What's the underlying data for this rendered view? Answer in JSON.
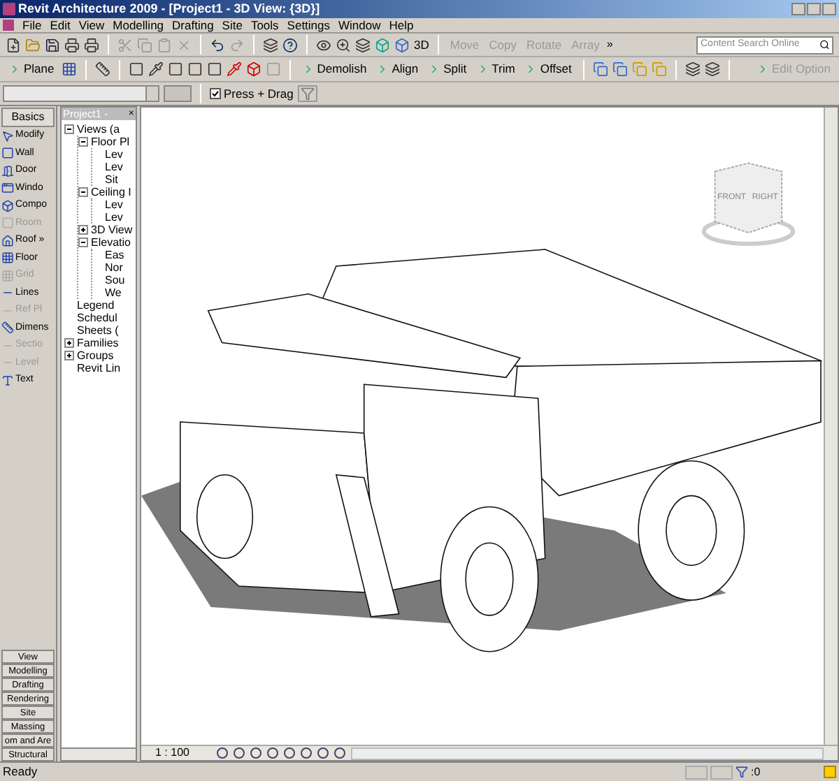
{
  "window": {
    "title": "Revit Architecture 2009 - [Project1 - 3D View: {3D}]"
  },
  "menu": [
    "File",
    "Edit",
    "View",
    "Modelling",
    "Drafting",
    "Site",
    "Tools",
    "Settings",
    "Window",
    "Help"
  ],
  "standard_toolbar": {
    "view_3d": "3D",
    "edit_tools": [
      {
        "label": "Move",
        "disabled": true
      },
      {
        "label": "Copy",
        "disabled": true
      },
      {
        "label": "Rotate",
        "disabled": true
      },
      {
        "label": "Array",
        "disabled": true
      }
    ],
    "overflow": "»"
  },
  "search": {
    "placeholder": "Content Search Online"
  },
  "tools_toolbar": [
    {
      "label": "Plane",
      "disabled": false
    },
    {
      "label": "Demolish",
      "disabled": false
    },
    {
      "label": "Align",
      "disabled": false
    },
    {
      "label": "Split",
      "disabled": false
    },
    {
      "label": "Trim",
      "disabled": false
    },
    {
      "label": "Offset",
      "disabled": false
    },
    {
      "label": "Edit Option",
      "disabled": true
    }
  ],
  "options_bar": {
    "press_drag": {
      "label": "Press + Drag",
      "checked": true
    }
  },
  "design_bar": {
    "tab": "Basics",
    "tools": [
      {
        "label": "Modify",
        "disabled": false
      },
      {
        "label": "Wall",
        "disabled": false
      },
      {
        "label": "Door",
        "disabled": false
      },
      {
        "label": "Windo",
        "disabled": false
      },
      {
        "label": "Compo",
        "disabled": false
      },
      {
        "label": "Room",
        "disabled": true
      },
      {
        "label": "Roof »",
        "disabled": false
      },
      {
        "label": "Floor",
        "disabled": false
      },
      {
        "label": "Grid",
        "disabled": true
      },
      {
        "label": "Lines",
        "disabled": false
      },
      {
        "label": "Ref Pl",
        "disabled": true
      },
      {
        "label": "Dimens",
        "disabled": false
      },
      {
        "label": "Sectio",
        "disabled": true
      },
      {
        "label": "Level",
        "disabled": true
      },
      {
        "label": "Text",
        "disabled": false
      }
    ],
    "tabs": [
      "View",
      "Modelling",
      "Drafting",
      "Rendering",
      "Site",
      "Massing",
      "om and Are",
      "Structural"
    ]
  },
  "project_browser": {
    "title": "Project1 -",
    "close": "×",
    "tree": [
      {
        "label": "Views (a",
        "expanded": true,
        "children": [
          {
            "label": "Floor Pl",
            "expanded": true,
            "children": [
              {
                "label": "Lev"
              },
              {
                "label": "Lev"
              },
              {
                "label": "Sit"
              }
            ]
          },
          {
            "label": "Ceiling I",
            "expanded": true,
            "children": [
              {
                "label": "Lev"
              },
              {
                "label": "Lev"
              }
            ]
          },
          {
            "label": "3D View",
            "expanded": false
          },
          {
            "label": "Elevatio",
            "expanded": true,
            "children": [
              {
                "label": "Eas"
              },
              {
                "label": "Nor"
              },
              {
                "label": "Sou"
              },
              {
                "label": "We"
              }
            ]
          }
        ]
      },
      {
        "label": "Legend"
      },
      {
        "label": "Schedul"
      },
      {
        "label": "Sheets ("
      },
      {
        "label": "Families",
        "expanded": false
      },
      {
        "label": "Groups",
        "expanded": false
      },
      {
        "label": "Revit Lin"
      }
    ]
  },
  "view_cube": {
    "front": "FRONT",
    "right": "RIGHT"
  },
  "view_control_bar": {
    "scale": "1 : 100"
  },
  "status_bar": {
    "message": "Ready",
    "filter_count": ":0"
  }
}
